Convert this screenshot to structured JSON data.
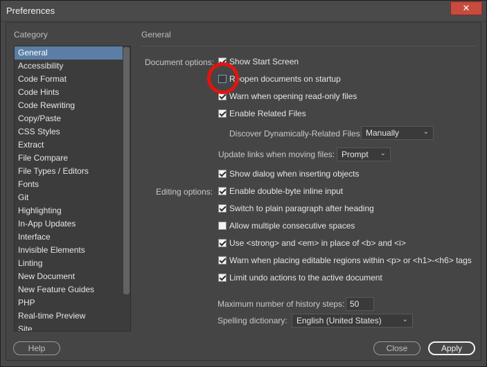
{
  "window": {
    "title": "Preferences",
    "close_glyph": "✕"
  },
  "category_header": "Category",
  "section_header": "General",
  "categories": [
    "General",
    "Accessibility",
    "Code Format",
    "Code Hints",
    "Code Rewriting",
    "Copy/Paste",
    "CSS Styles",
    "Extract",
    "File Compare",
    "File Types / Editors",
    "Fonts",
    "Git",
    "Highlighting",
    "In-App Updates",
    "Interface",
    "Invisible Elements",
    "Linting",
    "New Document",
    "New Feature Guides",
    "PHP",
    "Real-time Preview",
    "Site"
  ],
  "selected_category": "General",
  "document_options": {
    "label": "Document options:",
    "show_start_screen": {
      "label": "Show Start Screen",
      "checked": true
    },
    "reopen_documents": {
      "label": "Reopen documents on startup",
      "checked": false
    },
    "warn_read_only": {
      "label": "Warn when opening read-only files",
      "checked": true
    },
    "enable_related_files": {
      "label": "Enable Related Files",
      "checked": true
    },
    "discover_related": {
      "label": "Discover Dynamically-Related Files:",
      "value": "Manually"
    },
    "update_links": {
      "label": "Update links when moving files:",
      "value": "Prompt"
    },
    "show_dialog": {
      "label": "Show dialog when inserting objects",
      "checked": true
    }
  },
  "editing_options": {
    "label": "Editing options:",
    "double_byte": {
      "label": "Enable double-byte inline input",
      "checked": true
    },
    "plain_paragraph": {
      "label": "Switch to plain paragraph after heading",
      "checked": true
    },
    "multiple_spaces": {
      "label": "Allow multiple consecutive spaces",
      "checked": false
    },
    "strong_em": {
      "label": "Use <strong> and <em> in place of <b> and <i>",
      "checked": true
    },
    "warn_editable": {
      "label": "Warn when placing editable regions within <p> or <h1>-<h6> tags",
      "checked": true
    },
    "limit_undo": {
      "label": "Limit undo actions to the active document",
      "checked": true
    }
  },
  "history": {
    "label": "Maximum number of history steps:",
    "value": "50"
  },
  "spelling": {
    "label": "Spelling dictionary:",
    "value": "English (United States)"
  },
  "buttons": {
    "help": "Help",
    "close": "Close",
    "apply": "Apply"
  },
  "icons": {
    "dropdown": "chevron-down-icon",
    "check": "checkmark-icon"
  },
  "colors": {
    "selection": "#5b7ea6",
    "highlight_ring": "#e3130f",
    "close_button": "#c74b3e"
  }
}
